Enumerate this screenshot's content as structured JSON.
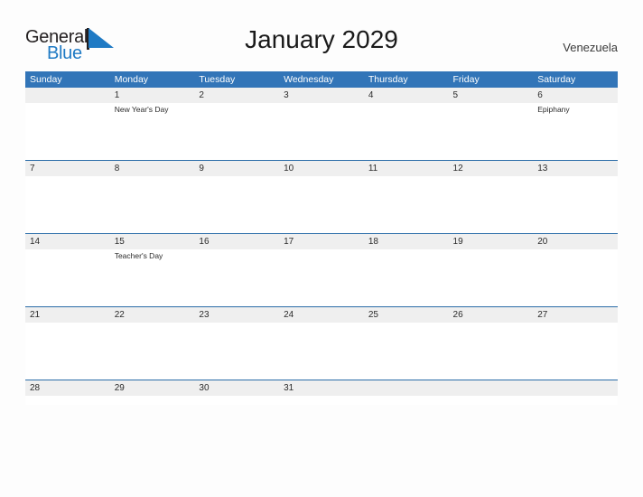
{
  "brand": {
    "name_part1": "General",
    "name_part2": "Blue",
    "accent_color": "#1f7ac4",
    "dark_color": "#231f20",
    "sail_icon": "sail-triangle-icon"
  },
  "header": {
    "title": "January 2029",
    "country": "Venezuela"
  },
  "calendar": {
    "header_bg": "#3275b8",
    "header_text_color": "#ffffff",
    "date_band_bg": "#efefef",
    "week_separator_color": "#2a6ca8",
    "day_names": [
      "Sunday",
      "Monday",
      "Tuesday",
      "Wednesday",
      "Thursday",
      "Friday",
      "Saturday"
    ],
    "weeks": [
      {
        "days": [
          {
            "date": "",
            "events": []
          },
          {
            "date": "1",
            "events": [
              "New Year's Day"
            ]
          },
          {
            "date": "2",
            "events": []
          },
          {
            "date": "3",
            "events": []
          },
          {
            "date": "4",
            "events": []
          },
          {
            "date": "5",
            "events": []
          },
          {
            "date": "6",
            "events": [
              "Epiphany"
            ]
          }
        ]
      },
      {
        "days": [
          {
            "date": "7",
            "events": []
          },
          {
            "date": "8",
            "events": []
          },
          {
            "date": "9",
            "events": []
          },
          {
            "date": "10",
            "events": []
          },
          {
            "date": "11",
            "events": []
          },
          {
            "date": "12",
            "events": []
          },
          {
            "date": "13",
            "events": []
          }
        ]
      },
      {
        "days": [
          {
            "date": "14",
            "events": []
          },
          {
            "date": "15",
            "events": [
              "Teacher's Day"
            ]
          },
          {
            "date": "16",
            "events": []
          },
          {
            "date": "17",
            "events": []
          },
          {
            "date": "18",
            "events": []
          },
          {
            "date": "19",
            "events": []
          },
          {
            "date": "20",
            "events": []
          }
        ]
      },
      {
        "days": [
          {
            "date": "21",
            "events": []
          },
          {
            "date": "22",
            "events": []
          },
          {
            "date": "23",
            "events": []
          },
          {
            "date": "24",
            "events": []
          },
          {
            "date": "25",
            "events": []
          },
          {
            "date": "26",
            "events": []
          },
          {
            "date": "27",
            "events": []
          }
        ]
      },
      {
        "days": [
          {
            "date": "28",
            "events": []
          },
          {
            "date": "29",
            "events": []
          },
          {
            "date": "30",
            "events": []
          },
          {
            "date": "31",
            "events": []
          },
          {
            "date": "",
            "events": []
          },
          {
            "date": "",
            "events": []
          },
          {
            "date": "",
            "events": []
          }
        ]
      }
    ]
  }
}
